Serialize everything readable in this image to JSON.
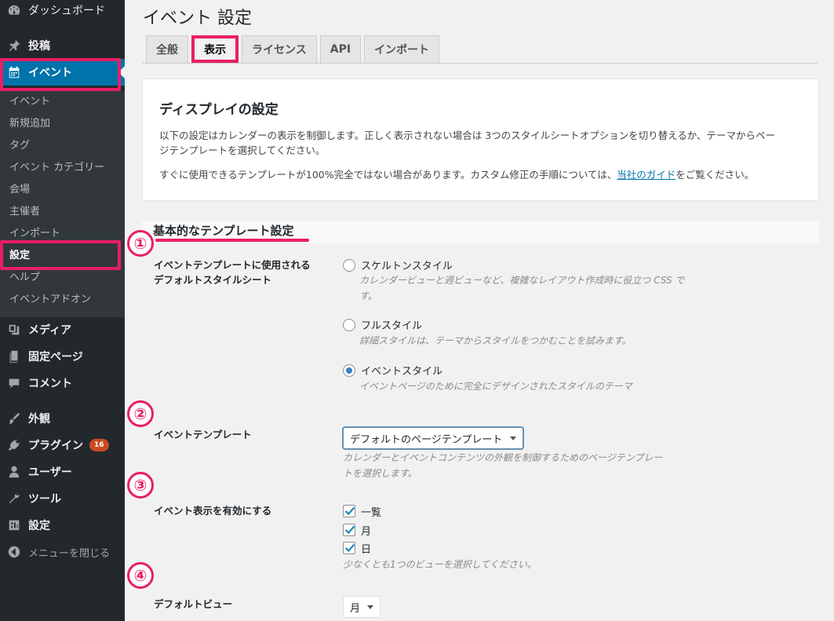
{
  "sidebar": {
    "top": [
      {
        "label": "ダッシュボード",
        "icon": "dashboard-icon"
      },
      {
        "label": "投稿",
        "icon": "pin-icon"
      },
      {
        "label": "イベント",
        "icon": "calendar-icon"
      }
    ],
    "submenu": [
      "イベント",
      "新規追加",
      "タグ",
      "イベント カテゴリー",
      "会場",
      "主催者",
      "インポート",
      "設定",
      "ヘルプ",
      "イベントアドオン"
    ],
    "bottom": [
      {
        "label": "メディア",
        "icon": "media-icon"
      },
      {
        "label": "固定ページ",
        "icon": "page-icon"
      },
      {
        "label": "コメント",
        "icon": "comment-icon"
      },
      {
        "label": "外観",
        "icon": "brush-icon"
      },
      {
        "label": "プラグイン",
        "icon": "plugin-icon",
        "badge": "16"
      },
      {
        "label": "ユーザー",
        "icon": "user-icon"
      },
      {
        "label": "ツール",
        "icon": "wrench-icon"
      },
      {
        "label": "設定",
        "icon": "settings-icon"
      },
      {
        "label": "メニューを閉じる",
        "icon": "collapse-icon"
      }
    ]
  },
  "page": {
    "title": "イベント 設定",
    "tabs": [
      "全般",
      "表示",
      "ライセンス",
      "API",
      "インポート"
    ],
    "active_tab": "表示"
  },
  "info": {
    "heading": "ディスプレイの設定",
    "p1_line1": "以下の設定はカレンダーの表示を制御します。正しく表示されない場合は 3つのスタイルシートオプションを切り替えるか、テーマからペー",
    "p1_line2": "ジテンプレートを選択してください。",
    "p2_before": "すぐに使用できるテンプレートが100%完全ではない場合があります。カスタム修正の手順については、",
    "p2_link": "当社のガイド",
    "p2_after": "をご覧ください。"
  },
  "section": {
    "title": "基本的なテンプレート設定",
    "stylesheet": {
      "label_line1": "イベントテンプレートに使用される",
      "label_line2": "デフォルトスタイルシート",
      "options": [
        {
          "label": "スケルトンスタイル",
          "desc_line1": "カレンダービューと週ビューなど、複雑なレイアウト作成時に役立つ CSS で",
          "desc_line2": "す。",
          "checked": false
        },
        {
          "label": "フルスタイル",
          "desc_line1": "詳細スタイルは、テーマからスタイルをつかむことを試みます。",
          "checked": false
        },
        {
          "label": "イベントスタイル",
          "desc_line1": "イベントページのために完全にデザインされたスタイルのテーマ",
          "checked": true
        }
      ]
    },
    "template": {
      "label": "イベントテンプレート",
      "value": "デフォルトのページテンプレート",
      "desc_line1": "カレンダーとイベントコンテンツの外観を制御するためのページテンプレー",
      "desc_line2": "トを選択します。"
    },
    "views": {
      "label": "イベント表示を有効にする",
      "options": [
        {
          "label": "一覧",
          "checked": true
        },
        {
          "label": "月",
          "checked": true
        },
        {
          "label": "日",
          "checked": true
        }
      ],
      "desc": "少なくとも1つのビューを選択してください。"
    },
    "default_view": {
      "label": "デフォルトビュー",
      "value": "月"
    }
  },
  "annotations": [
    "①",
    "②",
    "③",
    "④"
  ],
  "colors": {
    "highlight": "#e91e63",
    "admin_blue": "#0073aa",
    "sidebar": "#23282d"
  }
}
